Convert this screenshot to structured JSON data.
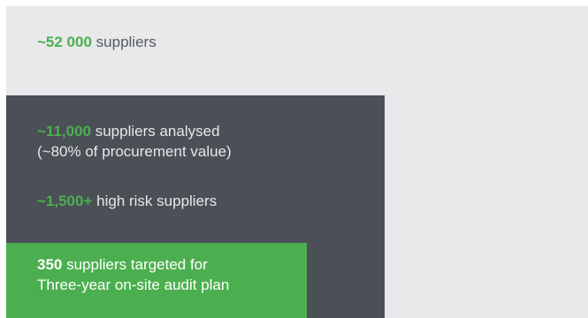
{
  "tiers": {
    "all": {
      "count": "~52 000",
      "label": " suppliers"
    },
    "analysed": {
      "count": "~11,000",
      "label": " suppliers analysed",
      "note": "(~80% of procurement value)"
    },
    "high_risk": {
      "count": "~1,500+",
      "label": " high risk suppliers"
    },
    "targeted": {
      "count": "350",
      "label": " suppliers targeted for",
      "note": "Three-year on-site audit plan"
    }
  },
  "colors": {
    "outer_bg": "#e8e9ea",
    "middle_bg": "#4b5057",
    "inner_bg": "#4caf4f",
    "accent_green": "#4caf4f"
  }
}
